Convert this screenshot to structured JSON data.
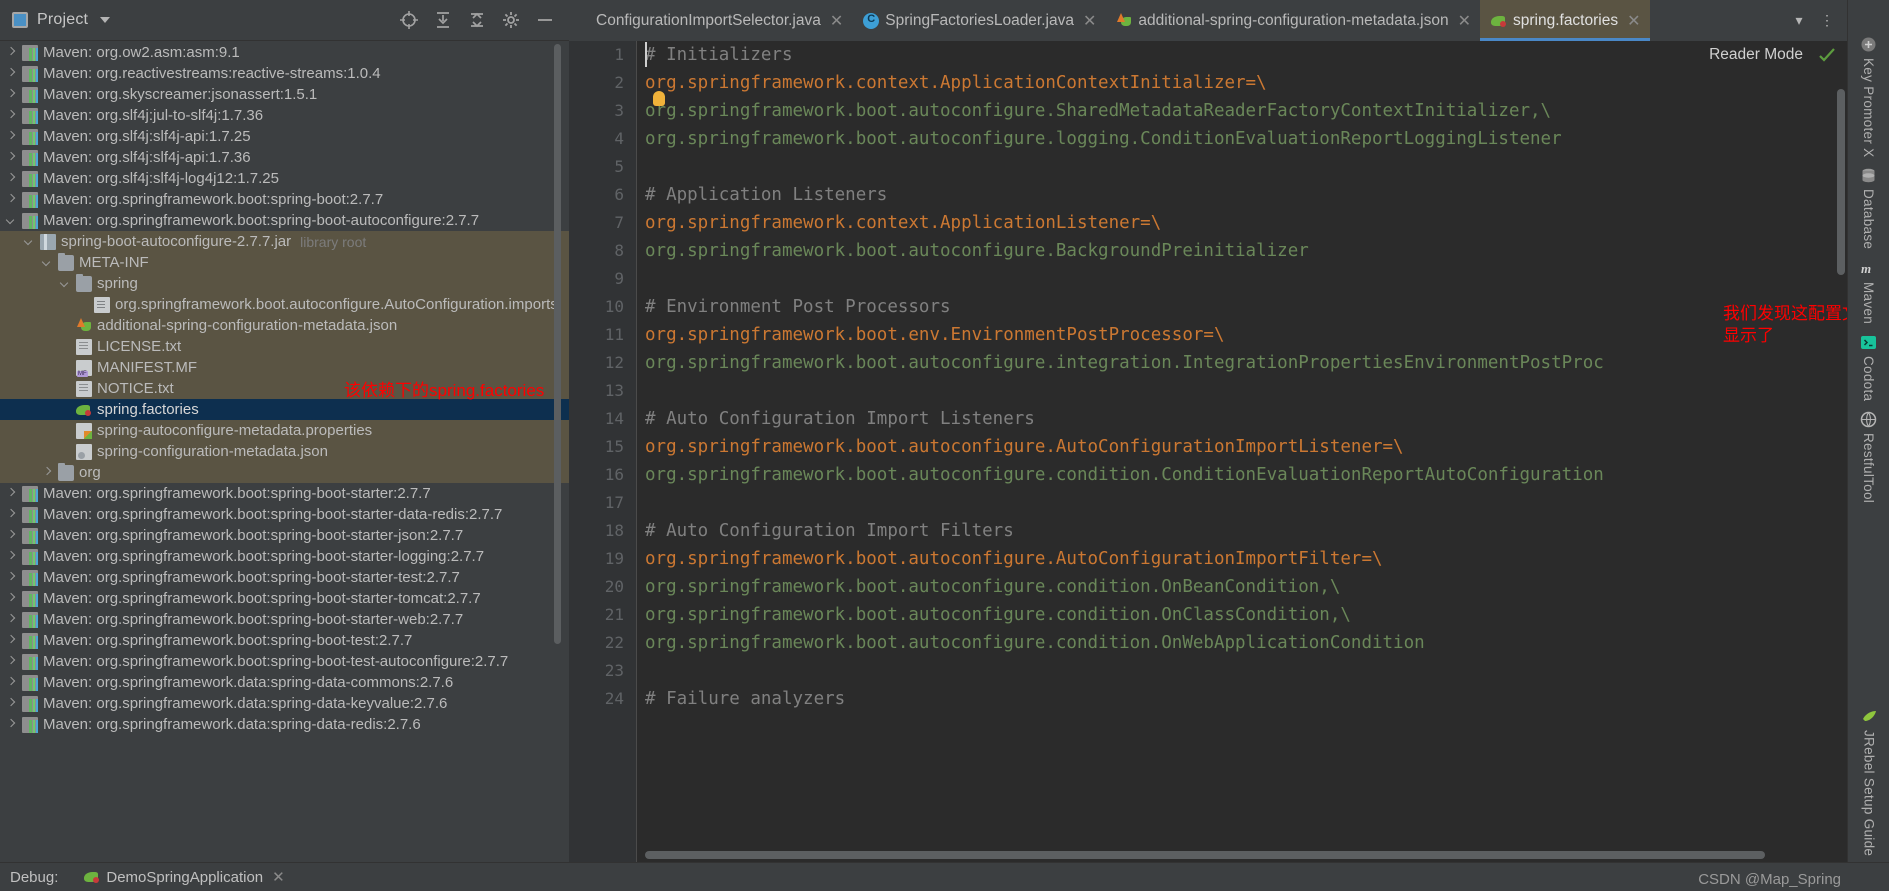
{
  "project_panel": {
    "title": "Project",
    "icon": "project-icon",
    "tools": [
      "locate-icon",
      "collapse-all-icon",
      "expand-icon",
      "settings-gear-icon",
      "hide-icon"
    ],
    "tree": [
      {
        "indent": 1,
        "arrow": "right",
        "icon": "maven-icon",
        "label": "Maven: org.ow2.asm:asm:9.1"
      },
      {
        "indent": 1,
        "arrow": "right",
        "icon": "maven-icon",
        "label": "Maven: org.reactivestreams:reactive-streams:1.0.4"
      },
      {
        "indent": 1,
        "arrow": "right",
        "icon": "maven-icon",
        "label": "Maven: org.skyscreamer:jsonassert:1.5.1"
      },
      {
        "indent": 1,
        "arrow": "right",
        "icon": "maven-icon",
        "label": "Maven: org.slf4j:jul-to-slf4j:1.7.36"
      },
      {
        "indent": 1,
        "arrow": "right",
        "icon": "maven-icon",
        "label": "Maven: org.slf4j:slf4j-api:1.7.25"
      },
      {
        "indent": 1,
        "arrow": "right",
        "icon": "maven-icon",
        "label": "Maven: org.slf4j:slf4j-api:1.7.36"
      },
      {
        "indent": 1,
        "arrow": "right",
        "icon": "maven-icon",
        "label": "Maven: org.slf4j:slf4j-log4j12:1.7.25"
      },
      {
        "indent": 1,
        "arrow": "right",
        "icon": "maven-icon",
        "label": "Maven: org.springframework.boot:spring-boot:2.7.7"
      },
      {
        "indent": 1,
        "arrow": "down",
        "icon": "maven-icon",
        "label": "Maven: org.springframework.boot:spring-boot-autoconfigure:2.7.7"
      },
      {
        "indent": 2,
        "arrow": "down",
        "icon": "jar-icon",
        "label": "spring-boot-autoconfigure-2.7.7.jar",
        "suffix": "library root",
        "state": "lib"
      },
      {
        "indent": 3,
        "arrow": "down",
        "icon": "folder-icon",
        "label": "META-INF",
        "state": "lib"
      },
      {
        "indent": 4,
        "arrow": "down",
        "icon": "folder-icon",
        "label": "spring",
        "state": "lib"
      },
      {
        "indent": 5,
        "arrow": "none",
        "icon": "imports-file-icon",
        "label": "org.springframework.boot.autoconfigure.AutoConfiguration.imports",
        "state": "lib"
      },
      {
        "indent": 4,
        "arrow": "none",
        "icon": "spring-json-icon",
        "label": "additional-spring-configuration-metadata.json",
        "state": "lib"
      },
      {
        "indent": 4,
        "arrow": "none",
        "icon": "txt-file-icon",
        "label": "LICENSE.txt",
        "state": "lib"
      },
      {
        "indent": 4,
        "arrow": "none",
        "icon": "manifest-icon",
        "label": "MANIFEST.MF",
        "state": "lib"
      },
      {
        "indent": 4,
        "arrow": "none",
        "icon": "txt-file-icon",
        "label": "NOTICE.txt",
        "state": "lib"
      },
      {
        "indent": 4,
        "arrow": "none",
        "icon": "spring-factories-icon",
        "label": "spring.factories",
        "state": "selected"
      },
      {
        "indent": 4,
        "arrow": "none",
        "icon": "properties-icon",
        "label": "spring-autoconfigure-metadata.properties",
        "state": "lib"
      },
      {
        "indent": 4,
        "arrow": "none",
        "icon": "json-icon",
        "label": "spring-configuration-metadata.json",
        "state": "lib"
      },
      {
        "indent": 3,
        "arrow": "right",
        "icon": "folder-icon",
        "label": "org",
        "state": "lib"
      },
      {
        "indent": 1,
        "arrow": "right",
        "icon": "maven-icon",
        "label": "Maven: org.springframework.boot:spring-boot-starter:2.7.7"
      },
      {
        "indent": 1,
        "arrow": "right",
        "icon": "maven-icon",
        "label": "Maven: org.springframework.boot:spring-boot-starter-data-redis:2.7.7"
      },
      {
        "indent": 1,
        "arrow": "right",
        "icon": "maven-icon",
        "label": "Maven: org.springframework.boot:spring-boot-starter-json:2.7.7"
      },
      {
        "indent": 1,
        "arrow": "right",
        "icon": "maven-icon",
        "label": "Maven: org.springframework.boot:spring-boot-starter-logging:2.7.7"
      },
      {
        "indent": 1,
        "arrow": "right",
        "icon": "maven-icon",
        "label": "Maven: org.springframework.boot:spring-boot-starter-test:2.7.7"
      },
      {
        "indent": 1,
        "arrow": "right",
        "icon": "maven-icon",
        "label": "Maven: org.springframework.boot:spring-boot-starter-tomcat:2.7.7"
      },
      {
        "indent": 1,
        "arrow": "right",
        "icon": "maven-icon",
        "label": "Maven: org.springframework.boot:spring-boot-starter-web:2.7.7"
      },
      {
        "indent": 1,
        "arrow": "right",
        "icon": "maven-icon",
        "label": "Maven: org.springframework.boot:spring-boot-test:2.7.7"
      },
      {
        "indent": 1,
        "arrow": "right",
        "icon": "maven-icon",
        "label": "Maven: org.springframework.boot:spring-boot-test-autoconfigure:2.7.7"
      },
      {
        "indent": 1,
        "arrow": "right",
        "icon": "maven-icon",
        "label": "Maven: org.springframework.data:spring-data-commons:2.7.6"
      },
      {
        "indent": 1,
        "arrow": "right",
        "icon": "maven-icon",
        "label": "Maven: org.springframework.data:spring-data-keyvalue:2.7.6"
      },
      {
        "indent": 1,
        "arrow": "right",
        "icon": "maven-icon",
        "label": "Maven: org.springframework.data:spring-data-redis:2.7.6"
      }
    ]
  },
  "annotations": {
    "tree_note": "该依赖下的spring.factories",
    "editor_note": "我们发现这配置文件中全是以键值对的方式\n显示了",
    "color": "#fe0000"
  },
  "editor": {
    "tabs": [
      {
        "label": "ConfigurationImportSelector.java",
        "icon": "java-class-icon",
        "active": false,
        "closable": true
      },
      {
        "label": "SpringFactoriesLoader.java",
        "icon": "java-class-icon",
        "active": false,
        "closable": true
      },
      {
        "label": "additional-spring-configuration-metadata.json",
        "icon": "spring-json-icon",
        "active": false,
        "closable": true
      },
      {
        "label": "spring.factories",
        "icon": "spring-factories-icon",
        "active": true,
        "closable": true
      }
    ],
    "tab_overflow_icon": "chevron-down-icon",
    "tab_menu_icon": "more-vertical-icon",
    "reader_mode_label": "Reader Mode",
    "reader_mode_check_icon": "green-check-icon",
    "active_tab_underline_color": "#4a88c7",
    "syntax_colors": {
      "comment": "#808080",
      "key": "#cc7832",
      "value": "#6a8759",
      "separator": "#a9b7c6"
    },
    "lines": [
      {
        "n": 1,
        "type": "comment",
        "text": "# Initializers"
      },
      {
        "n": 2,
        "type": "key",
        "text": "org.springframework.context.ApplicationContextInitializer=\\"
      },
      {
        "n": 3,
        "type": "value",
        "text": "org.springframework.boot.autoconfigure.SharedMetadataReaderFactoryContextInitializer,\\"
      },
      {
        "n": 4,
        "type": "value",
        "text": "org.springframework.boot.autoconfigure.logging.ConditionEvaluationReportLoggingListener"
      },
      {
        "n": 5,
        "type": "blank",
        "text": ""
      },
      {
        "n": 6,
        "type": "comment",
        "text": "# Application Listeners"
      },
      {
        "n": 7,
        "type": "key",
        "text": "org.springframework.context.ApplicationListener=\\"
      },
      {
        "n": 8,
        "type": "value",
        "text": "org.springframework.boot.autoconfigure.BackgroundPreinitializer"
      },
      {
        "n": 9,
        "type": "blank",
        "text": ""
      },
      {
        "n": 10,
        "type": "comment",
        "text": "# Environment Post Processors"
      },
      {
        "n": 11,
        "type": "key",
        "text": "org.springframework.boot.env.EnvironmentPostProcessor=\\"
      },
      {
        "n": 12,
        "type": "value",
        "text": "org.springframework.boot.autoconfigure.integration.IntegrationPropertiesEnvironmentPostProc"
      },
      {
        "n": 13,
        "type": "blank",
        "text": ""
      },
      {
        "n": 14,
        "type": "comment",
        "text": "# Auto Configuration Import Listeners"
      },
      {
        "n": 15,
        "type": "key",
        "text": "org.springframework.boot.autoconfigure.AutoConfigurationImportListener=\\"
      },
      {
        "n": 16,
        "type": "value",
        "text": "org.springframework.boot.autoconfigure.condition.ConditionEvaluationReportAutoConfiguration"
      },
      {
        "n": 17,
        "type": "blank",
        "text": ""
      },
      {
        "n": 18,
        "type": "comment",
        "text": "# Auto Configuration Import Filters"
      },
      {
        "n": 19,
        "type": "key",
        "text": "org.springframework.boot.autoconfigure.AutoConfigurationImportFilter=\\"
      },
      {
        "n": 20,
        "type": "value",
        "text": "org.springframework.boot.autoconfigure.condition.OnBeanCondition,\\"
      },
      {
        "n": 21,
        "type": "value",
        "text": "org.springframework.boot.autoconfigure.condition.OnClassCondition,\\"
      },
      {
        "n": 22,
        "type": "value",
        "text": "org.springframework.boot.autoconfigure.condition.OnWebApplicationCondition"
      },
      {
        "n": 23,
        "type": "blank",
        "text": ""
      },
      {
        "n": 24,
        "type": "comment",
        "text": "# Failure analyzers"
      }
    ]
  },
  "right_rail": {
    "items": [
      {
        "label": "Key Promoter X",
        "icon": "key-promoter-icon"
      },
      {
        "label": "Database",
        "icon": "database-icon"
      },
      {
        "label": "Maven",
        "icon": "maven-m-icon"
      },
      {
        "label": "Codota",
        "icon": "codota-icon"
      },
      {
        "label": "RestfulTool",
        "icon": "restful-tool-icon"
      }
    ],
    "bottom": {
      "label": "JRebel Setup Guide",
      "icon": "jrebel-icon"
    }
  },
  "statusbar": {
    "debug_label": "Debug:",
    "run_config": "DemoSpringApplication",
    "run_icon": "spring-debug-icon",
    "close_icon": "close-icon",
    "watermark": "CSDN @Map_Spring"
  }
}
